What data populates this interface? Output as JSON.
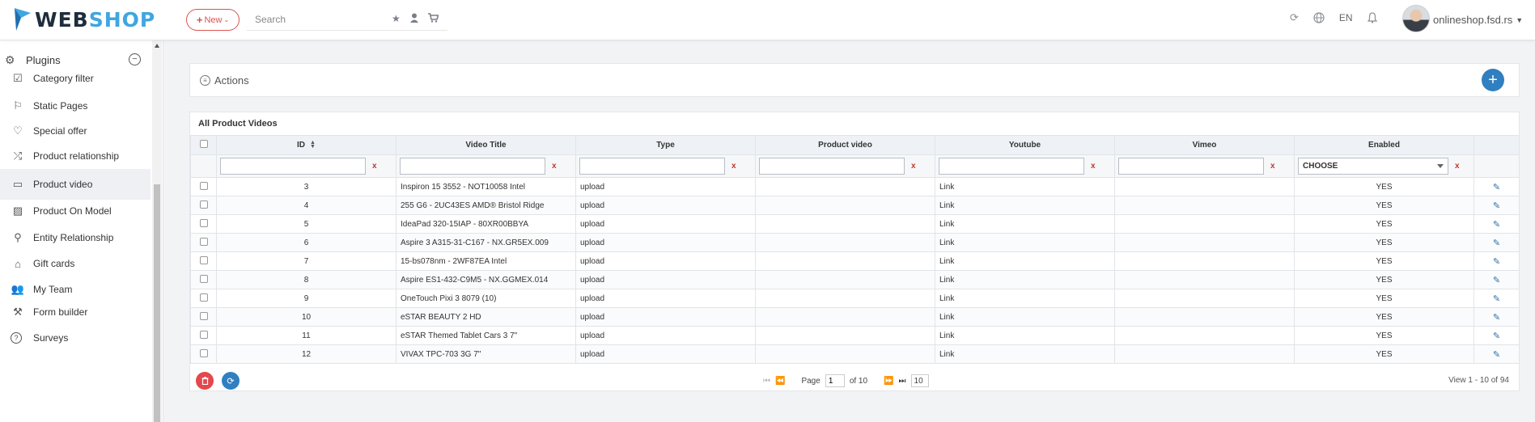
{
  "header": {
    "logo_web": "WEB",
    "logo_shop": "SHOP",
    "new_label": "New",
    "search_placeholder": "Search",
    "language": "EN",
    "user_name": "onlineshop.fsd.rs"
  },
  "sidebar": {
    "section_title": "Plugins",
    "items": [
      {
        "label": "Category filter",
        "icon": "checkbox-icon"
      },
      {
        "label": "Static Pages",
        "icon": "bookmark-icon"
      },
      {
        "label": "Special offer",
        "icon": "heart-icon"
      },
      {
        "label": "Product relationship",
        "icon": "shuffle-icon"
      },
      {
        "label": "Product video",
        "icon": "video-icon"
      },
      {
        "label": "Product On Model",
        "icon": "image-icon"
      },
      {
        "label": "Entity Relationship",
        "icon": "link-icon"
      },
      {
        "label": "Gift cards",
        "icon": "gift-icon"
      },
      {
        "label": "My Team",
        "icon": "team-icon"
      },
      {
        "label": "Form builder",
        "icon": "form-icon"
      },
      {
        "label": "Surveys",
        "icon": "question-icon"
      }
    ],
    "active_index": 4
  },
  "actions": {
    "title": "Actions"
  },
  "grid": {
    "caption": "All Product Videos",
    "columns": [
      "ID",
      "Video Title",
      "Type",
      "Product video",
      "Youtube",
      "Vimeo",
      "Enabled"
    ],
    "enabled_filter": "CHOOSE",
    "filter_clear": "x",
    "rows": [
      {
        "id": "3",
        "title": "Inspiron 15 3552 - NOT10058 Intel",
        "type": "upload",
        "product_video": "",
        "youtube": "Link",
        "vimeo": "",
        "enabled": "YES"
      },
      {
        "id": "4",
        "title": "255 G6 - 2UC43ES AMD® Bristol Ridge",
        "type": "upload",
        "product_video": "",
        "youtube": "Link",
        "vimeo": "",
        "enabled": "YES"
      },
      {
        "id": "5",
        "title": "IdeaPad 320-15IAP - 80XR00BBYA",
        "type": "upload",
        "product_video": "",
        "youtube": "Link",
        "vimeo": "",
        "enabled": "YES"
      },
      {
        "id": "6",
        "title": "Aspire 3 A315-31-C167 - NX.GR5EX.009",
        "type": "upload",
        "product_video": "",
        "youtube": "Link",
        "vimeo": "",
        "enabled": "YES"
      },
      {
        "id": "7",
        "title": " 15-bs078nm - 2WF87EA Intel",
        "type": "upload",
        "product_video": "",
        "youtube": "Link",
        "vimeo": "",
        "enabled": "YES"
      },
      {
        "id": "8",
        "title": " Aspire ES1-432-C9M5 - NX.GGMEX.014",
        "type": "upload",
        "product_video": "",
        "youtube": "Link",
        "vimeo": "",
        "enabled": "YES"
      },
      {
        "id": "9",
        "title": "OneTouch Pixi 3 8079 (10)",
        "type": "upload",
        "product_video": "",
        "youtube": "Link",
        "vimeo": "",
        "enabled": "YES"
      },
      {
        "id": "10",
        "title": "eSTAR BEAUTY 2 HD",
        "type": "upload",
        "product_video": "",
        "youtube": "Link",
        "vimeo": "",
        "enabled": "YES"
      },
      {
        "id": "11",
        "title": "eSTAR Themed Tablet Cars 3 7\"",
        "type": "upload",
        "product_video": "",
        "youtube": "Link",
        "vimeo": "",
        "enabled": "YES"
      },
      {
        "id": "12",
        "title": "VIVAX TPC-703 3G 7\"",
        "type": "upload",
        "product_video": "",
        "youtube": "Link",
        "vimeo": "",
        "enabled": "YES"
      }
    ]
  },
  "pager": {
    "page_label": "Page",
    "page_value": "1",
    "of_label": "of 10",
    "page_size": "10",
    "view_text": "View 1 - 10 of 94"
  }
}
